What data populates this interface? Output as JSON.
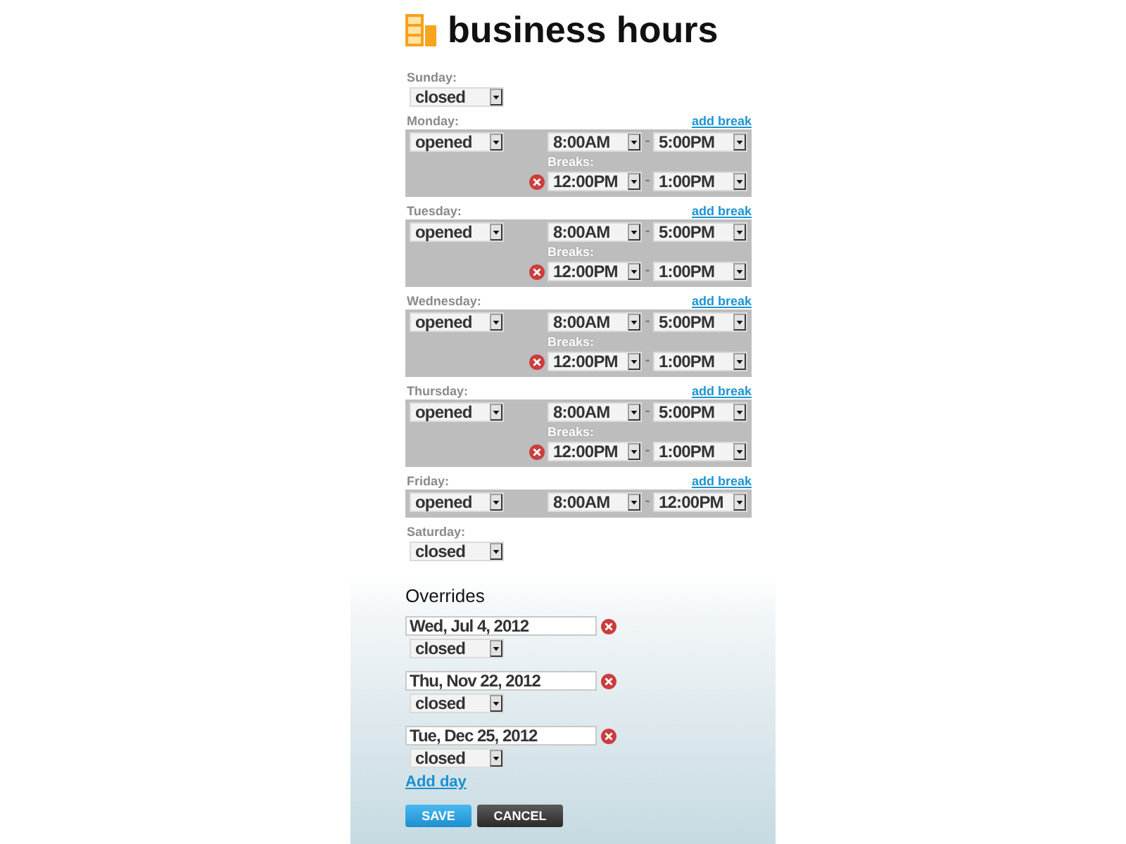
{
  "header": {
    "title": "business hours"
  },
  "days": [
    {
      "kind": "closed",
      "label": "Sunday:",
      "status": "closed"
    },
    {
      "kind": "open",
      "label": "Monday:",
      "add_break": "add break",
      "status": "opened",
      "hours": {
        "start": "8:00AM",
        "separator": "-",
        "end": "5:00PM"
      },
      "breaks_label": "Breaks:",
      "breaks": [
        {
          "start": "12:00PM",
          "separator": "-",
          "end": "1:00PM"
        }
      ]
    },
    {
      "kind": "open",
      "label": "Tuesday:",
      "add_break": "add break",
      "status": "opened",
      "hours": {
        "start": "8:00AM",
        "separator": "-",
        "end": "5:00PM"
      },
      "breaks_label": "Breaks:",
      "breaks": [
        {
          "start": "12:00PM",
          "separator": "-",
          "end": "1:00PM"
        }
      ]
    },
    {
      "kind": "open",
      "label": "Wednesday:",
      "add_break": "add break",
      "status": "opened",
      "hours": {
        "start": "8:00AM",
        "separator": "-",
        "end": "5:00PM"
      },
      "breaks_label": "Breaks:",
      "breaks": [
        {
          "start": "12:00PM",
          "separator": "-",
          "end": "1:00PM"
        }
      ]
    },
    {
      "kind": "open",
      "label": "Thursday:",
      "add_break": "add break",
      "status": "opened",
      "hours": {
        "start": "8:00AM",
        "separator": "-",
        "end": "5:00PM"
      },
      "breaks_label": "Breaks:",
      "breaks": [
        {
          "start": "12:00PM",
          "separator": "-",
          "end": "1:00PM"
        }
      ]
    },
    {
      "kind": "open",
      "label": "Friday:",
      "add_break": "add break",
      "status": "opened",
      "hours": {
        "start": "8:00AM",
        "separator": "-",
        "end": "12:00PM"
      }
    },
    {
      "kind": "closed",
      "label": "Saturday:",
      "status": "closed"
    }
  ],
  "overrides": {
    "title": "Overrides",
    "items": [
      {
        "date": "Wed, Jul 4, 2012",
        "status": "closed"
      },
      {
        "date": "Thu, Nov 22, 2012",
        "status": "closed"
      },
      {
        "date": "Tue, Dec 25, 2012",
        "status": "closed"
      }
    ],
    "add_day": "Add day"
  },
  "buttons": [
    {
      "kind": "primary",
      "label": "SAVE"
    },
    {
      "kind": "secondary",
      "label": "CANCEL"
    }
  ]
}
